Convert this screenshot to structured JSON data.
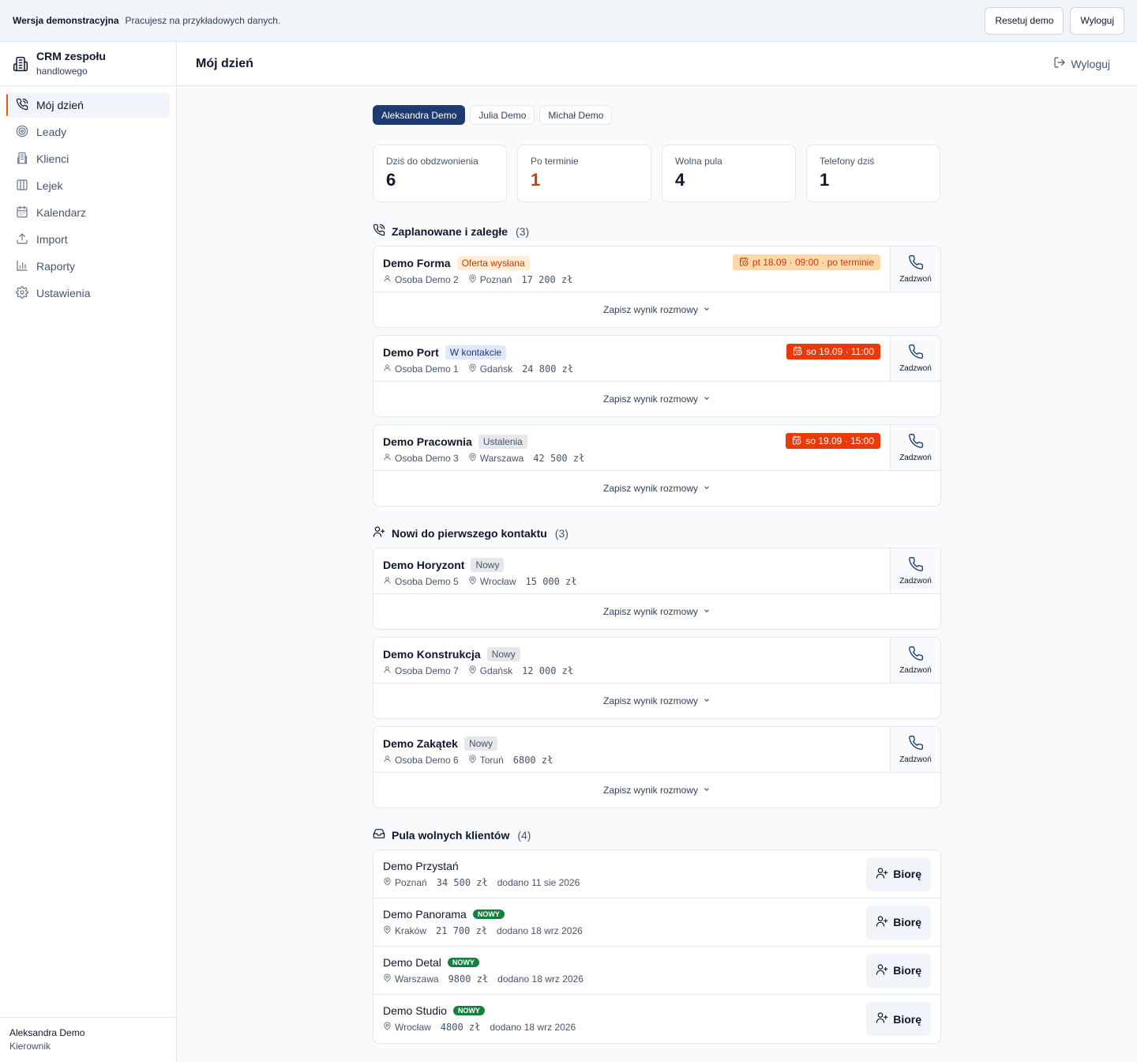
{
  "demo_bar": {
    "title": "Wersja demonstracyjna",
    "text": "Pracujesz na przykładowych danych.",
    "reset_label": "Resetuj demo",
    "logout_label": "Wyloguj"
  },
  "sidebar": {
    "brand_line1": "CRM zespołu",
    "brand_line2": "handlowego",
    "items": [
      {
        "label": "Mój dzień",
        "icon": "phone-call-icon"
      },
      {
        "label": "Leady",
        "icon": "target-icon"
      },
      {
        "label": "Klienci",
        "icon": "building-icon"
      },
      {
        "label": "Lejek",
        "icon": "columns-icon"
      },
      {
        "label": "Kalendarz",
        "icon": "calendar-icon"
      },
      {
        "label": "Import",
        "icon": "upload-icon"
      },
      {
        "label": "Raporty",
        "icon": "bar-chart-icon"
      },
      {
        "label": "Ustawienia",
        "icon": "gear-icon"
      }
    ],
    "user_name": "Aleksandra Demo",
    "user_role": "Kierownik"
  },
  "header": {
    "title": "Mój dzień",
    "logout_label": "Wyloguj"
  },
  "user_tabs": [
    "Aleksandra Demo",
    "Julia Demo",
    "Michał Demo"
  ],
  "stats": [
    {
      "label": "Dziś do obdzwonienia",
      "value": "6"
    },
    {
      "label": "Po terminie",
      "value": "1"
    },
    {
      "label": "Wolna pula",
      "value": "4"
    },
    {
      "label": "Telefony dziś",
      "value": "1"
    }
  ],
  "scheduled": {
    "title": "Zaplanowane i zaległe",
    "count": "(3)",
    "items": [
      {
        "name": "Demo Forma",
        "status": "Oferta wysłana",
        "person": "Osoba Demo 2",
        "city": "Poznań",
        "amount": "17 200 zł",
        "due": "pt 18.09 · 09:00 · po terminie"
      },
      {
        "name": "Demo Port",
        "status": "W kontakcie",
        "person": "Osoba Demo 1",
        "city": "Gdańsk",
        "amount": "24 800 zł",
        "due": "so 19.09 · 11:00"
      },
      {
        "name": "Demo Pracownia",
        "status": "Ustalenia",
        "person": "Osoba Demo 3",
        "city": "Warszawa",
        "amount": "42 500 zł",
        "due": "so 19.09 · 15:00"
      }
    ]
  },
  "new_contacts": {
    "title": "Nowi do pierwszego kontaktu",
    "count": "(3)",
    "items": [
      {
        "name": "Demo Horyzont",
        "status": "Nowy",
        "person": "Osoba Demo 5",
        "city": "Wrocław",
        "amount": "15 000 zł"
      },
      {
        "name": "Demo Konstrukcja",
        "status": "Nowy",
        "person": "Osoba Demo 7",
        "city": "Gdańsk",
        "amount": "12 000 zł"
      },
      {
        "name": "Demo Zakątek",
        "status": "Nowy",
        "person": "Osoba Demo 6",
        "city": "Toruń",
        "amount": "6800 zł"
      }
    ]
  },
  "call_label": "Zadzwoń",
  "result_label": "Zapisz wynik rozmowy",
  "pool": {
    "title": "Pula wolnych klientów",
    "count": "(4)",
    "take_label": "Biorę",
    "new_tag": "NOWY",
    "items": [
      {
        "name": "Demo Przystań",
        "city": "Poznań",
        "amount": "34 500 zł",
        "added": "dodano 11 sie 2026"
      },
      {
        "name": "Demo Panorama",
        "city": "Kraków",
        "amount": "21 700 zł",
        "added": "dodano 18 wrz 2026"
      },
      {
        "name": "Demo Detal",
        "city": "Warszawa",
        "amount": "9800 zł",
        "added": "dodano 18 wrz 2026"
      },
      {
        "name": "Demo Studio",
        "city": "Wrocław",
        "amount": "4800 zł",
        "added": "dodano 18 wrz 2026"
      }
    ]
  }
}
